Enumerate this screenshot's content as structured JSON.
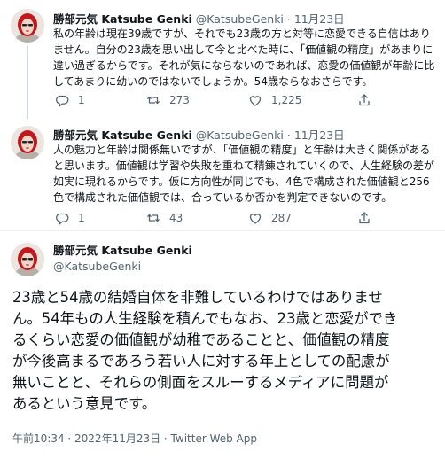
{
  "tweet1": {
    "name": "勝部元気 Katsube Genki",
    "handle": "@KatsubeGenki",
    "date": "· 11月23日",
    "lines": [
      "私の年齢は現在39歳ですが、それでも23歳の方と対等に恋愛できる自信はあり",
      "ません。自分の23歳を思い出して今と比べた時に、「価値観の精度」があまりに",
      "違い過ぎるからです。それが気にならないのであれば、恋愛の価値観が年齢に比",
      "してあまりに幼いのではないでしょうか。54歳ならなおさらです。"
    ],
    "reply_count": "1",
    "retweet_count": "273",
    "like_count": "1,225"
  },
  "tweet2": {
    "name": "勝部元気 Katsube Genki",
    "handle": "@KatsubeGenki",
    "date": "· 11月23日",
    "lines": [
      "人の魅力と年齢は関係無いですが、「価値観の精度」と年齢は大きく関係がある",
      "と思います。価値観は学習や失敗を重ねて精錬されていくので、人生経験の差が",
      "如実に現れるからです。仮に方向性が同じでも、4色で構成された価値観と256",
      "色で構成された価値観では、合っているか否かを判定できないのです。"
    ],
    "reply_count": "1",
    "retweet_count": "43",
    "like_count": "287"
  },
  "main_tweet": {
    "name": "勝部元気 Katsube Genki",
    "handle": "@KatsubeGenki",
    "lines": [
      "23歳と54歳の結婚自体を非難しているわけではありませ",
      "ん。54年もの人生経験を積んでもなお、23歳と恋愛ができ",
      "るくらい恋愛の価値観が幼稚であることと、価値観の精度",
      "が今後高まるであろう若い人に対する年上としての配慮が",
      "無いことと、それらの側面をスルーするメディアに問題が",
      "あるという意見です。"
    ],
    "meta": "午前10:34 · 2022年11月23日 · Twitter Web App"
  },
  "icons": {
    "reply": "reply-icon",
    "retweet": "retweet-icon",
    "like": "heart-icon",
    "share": "share-icon"
  },
  "colors": {
    "text": "#0f1419",
    "secondary": "#536471",
    "thread_line": "#cfd9de"
  }
}
